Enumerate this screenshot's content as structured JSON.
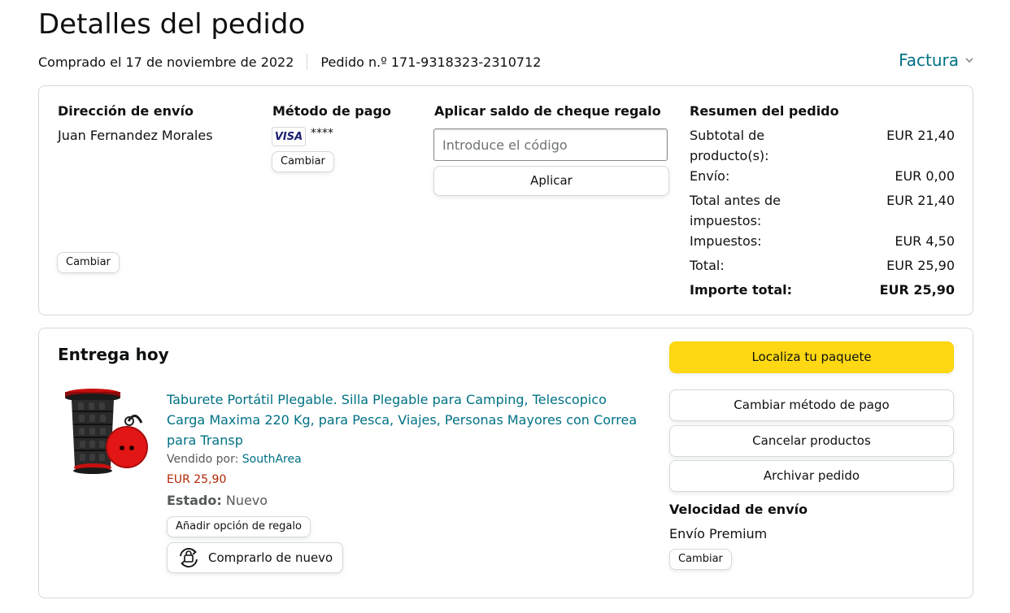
{
  "page": {
    "title": "Detalles del pedido",
    "purchased": "Comprado el 17 de noviembre de 2022",
    "order_number": "Pedido n.º 171-9318323-2310712",
    "invoice": "Factura"
  },
  "shipping": {
    "heading": "Dirección de envío",
    "name": "Juan Fernandez Morales",
    "change": "Cambiar"
  },
  "payment": {
    "heading": "Método de pago",
    "card_brand": "VISA",
    "card_mask": "****",
    "change": "Cambiar"
  },
  "giftcard": {
    "heading": "Aplicar saldo de cheque regalo",
    "placeholder": "Introduce el código",
    "apply": "Aplicar"
  },
  "summary": {
    "heading": "Resumen del pedido",
    "rows": [
      {
        "label": "Subtotal de producto(s):",
        "value": "EUR 21,40"
      },
      {
        "label": "Envío:",
        "value": "EUR 0,00"
      },
      {
        "label": "Total antes de impuestos:",
        "value": "EUR 21,40"
      },
      {
        "label": "Impuestos:",
        "value": "EUR 4,50"
      },
      {
        "label": "Total:",
        "value": "EUR 25,90"
      },
      {
        "label": "Importe total:",
        "value": "EUR 25,90"
      }
    ]
  },
  "delivery": {
    "heading": "Entrega hoy",
    "product_title": "Taburete Portátil Plegable. Silla Plegable para Camping, Telescopico Carga Maxima 220 Kg, para Pesca, Viajes, Personas Mayores con Correa para Transp",
    "sold_by_label": "Vendido por:",
    "seller": "SouthArea",
    "price": "EUR 25,90",
    "state_label": "Estado:",
    "state_value": "Nuevo",
    "gift_option": "Añadir opción de regalo",
    "buy_again": "Comprarlo de nuevo"
  },
  "actions": {
    "track": "Localiza tu paquete",
    "change_payment": "Cambiar método de pago",
    "cancel": "Cancelar productos",
    "archive": "Archivar pedido"
  },
  "speed": {
    "heading": "Velocidad de envío",
    "value": "Envío Premium",
    "change": "Cambiar"
  },
  "colors": {
    "link": "#007185",
    "price": "#b12704",
    "primary_button": "#ffd814",
    "border": "#d5d9d9"
  }
}
